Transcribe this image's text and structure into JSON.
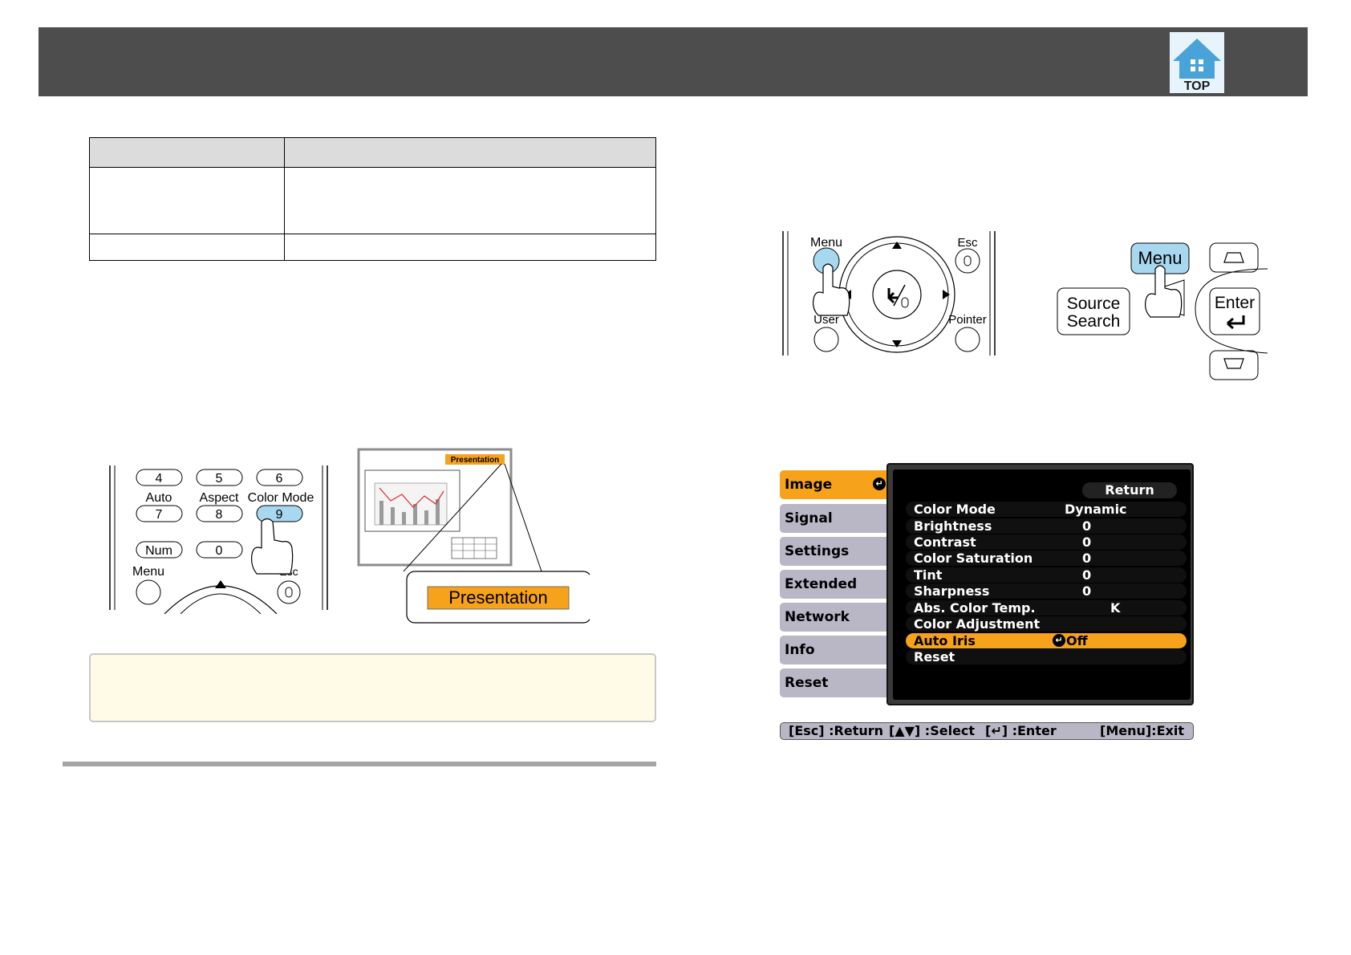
{
  "header": {
    "top_label": "TOP"
  },
  "remote_left": {
    "keys": [
      "4",
      "5",
      "6",
      "7",
      "8",
      "9",
      "Num",
      "0"
    ],
    "labels": [
      "Auto",
      "Aspect",
      "Color Mode",
      "Menu",
      "Esc"
    ]
  },
  "preview": {
    "small_badge": "Presentation",
    "callout_label": "Presentation"
  },
  "remote_right": {
    "labels": [
      "Menu",
      "Esc",
      "User",
      "Pointer"
    ]
  },
  "control_panel": {
    "menu_label": "Menu",
    "source_line1": "Source",
    "source_line2": "Search",
    "enter_label": "Enter"
  },
  "projector_menu": {
    "tabs": [
      "Image",
      "Signal",
      "Settings",
      "Extended",
      "Network",
      "Info",
      "Reset"
    ],
    "active_tab": "Image",
    "return_label": "Return",
    "rows": [
      {
        "label": "Color Mode",
        "value": "Dynamic"
      },
      {
        "label": "Brightness",
        "value": "0"
      },
      {
        "label": "Contrast",
        "value": "0"
      },
      {
        "label": "Color Saturation",
        "value": "0"
      },
      {
        "label": "Tint",
        "value": "0"
      },
      {
        "label": "Sharpness",
        "value": "0"
      },
      {
        "label": "Abs. Color Temp.",
        "value": "K"
      },
      {
        "label": "Color Adjustment",
        "value": ""
      },
      {
        "label": "Auto Iris",
        "value": "Off"
      },
      {
        "label": "Reset",
        "value": ""
      }
    ],
    "highlighted_row": "Auto Iris",
    "status": {
      "esc": "[Esc] :Return",
      "select": "[▲▼] :Select",
      "enter": "[↵] :Enter",
      "exit": "[Menu]:Exit"
    }
  },
  "colors": {
    "header_bg": "#4d4d4d",
    "highlight_orange": "#f7a21b",
    "tab_bg": "#b9b6c6",
    "button_blue": "#a8d8f0"
  }
}
